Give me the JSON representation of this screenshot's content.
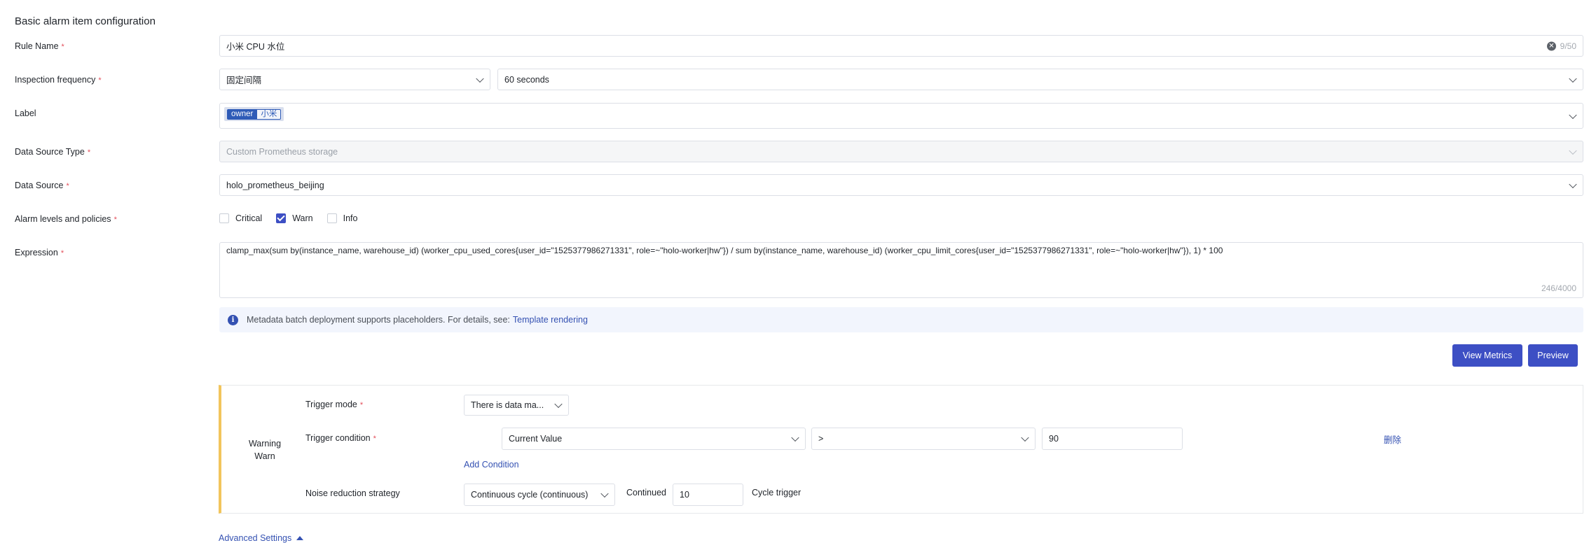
{
  "section_title": "Basic alarm item configuration",
  "rule_name": {
    "label": "Rule Name",
    "value": "小米 CPU 水位",
    "counter": "9/50",
    "clear_glyph": "✕"
  },
  "inspection_frequency": {
    "label": "Inspection frequency",
    "mode": "固定间隔",
    "interval": "60 seconds"
  },
  "label_field": {
    "label": "Label",
    "tag_key": "owner",
    "tag_value": "小米"
  },
  "data_source_type": {
    "label": "Data Source Type",
    "value": "Custom Prometheus storage"
  },
  "data_source": {
    "label": "Data Source",
    "value": "holo_prometheus_beijing"
  },
  "alarm_levels": {
    "label": "Alarm levels and policies",
    "options": [
      {
        "label": "Critical",
        "checked": false
      },
      {
        "label": "Warn",
        "checked": true
      },
      {
        "label": "Info",
        "checked": false
      }
    ]
  },
  "expression": {
    "label": "Expression",
    "value": "clamp_max(sum by(instance_name, warehouse_id) (worker_cpu_used_cores{user_id=\"1525377986271331\", role=~\"holo-worker|hw\"}) / sum by(instance_name, warehouse_id) (worker_cpu_limit_cores{user_id=\"1525377986271331\", role=~\"holo-worker|hw\"}), 1) * 100",
    "counter": "246/4000"
  },
  "info": {
    "icon_glyph": "i",
    "text": "Metadata batch deployment supports placeholders. For details, see:",
    "link": "Template rendering"
  },
  "buttons": {
    "view_metrics": "View Metrics",
    "preview": "Preview"
  },
  "warn_panel": {
    "level_title": "Warning",
    "level_sub": "Warn",
    "trigger_mode_label": "Trigger mode",
    "trigger_mode_value": "There is data ma...",
    "trigger_condition_label": "Trigger condition",
    "condition_metric": "Current Value",
    "condition_operator": ">",
    "condition_threshold": "90",
    "delete_label": "删除",
    "add_condition": "Add Condition",
    "noise_label": "Noise reduction strategy",
    "noise_value": "Continuous cycle (continuous)",
    "continued_label": "Continued",
    "continued_value": "10",
    "cycle_trigger_label": "Cycle trigger"
  },
  "advanced_settings": "Advanced Settings",
  "colors": {
    "accent": "#3d4fc4",
    "link": "#3451b2",
    "warn_border": "#f2c55c",
    "required": "#e34d59"
  }
}
